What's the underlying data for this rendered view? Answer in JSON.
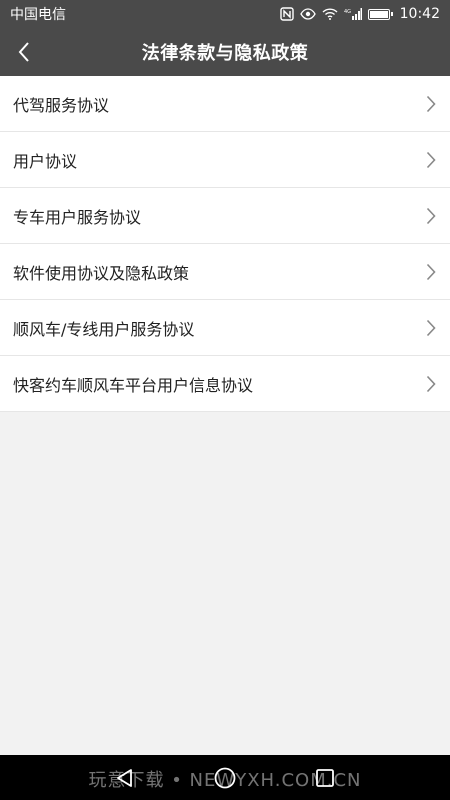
{
  "status_bar": {
    "carrier": "中国电信",
    "time": "10:42",
    "icons": [
      "nfc-icon",
      "eye-icon",
      "wifi-icon",
      "signal-icon",
      "battery-icon"
    ],
    "signal_label": "4G"
  },
  "header": {
    "title": "法律条款与隐私政策",
    "back_icon": "chevron-left-icon"
  },
  "list": {
    "items": [
      {
        "label": "代驾服务协议"
      },
      {
        "label": "用户协议"
      },
      {
        "label": "专车用户服务协议"
      },
      {
        "label": "软件使用协议及隐私政策"
      },
      {
        "label": "顺风车/专线用户服务协议"
      },
      {
        "label": "快客约车顺风车平台用户信息协议"
      }
    ]
  },
  "nav_bar": {
    "icons": [
      "nav-back-icon",
      "nav-home-icon",
      "nav-recent-icon"
    ]
  },
  "watermark": "玩意下载 • NEWYXH.COM.CN",
  "colors": {
    "header_bg": "#4a4a4a",
    "page_bg": "#f2f2f2",
    "item_bg": "#ffffff",
    "divider": "#e6e6e6",
    "chevron": "#888888",
    "nav_bg": "#000000"
  }
}
